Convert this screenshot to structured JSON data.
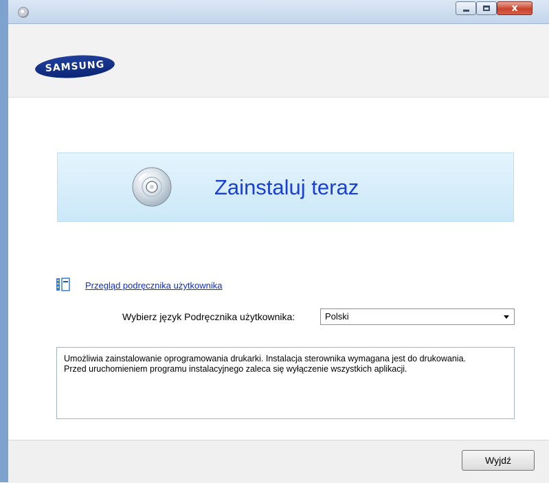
{
  "window": {
    "min_icon": "minimize-icon",
    "max_icon": "maximize-icon",
    "close_icon": "close-icon",
    "close_glyph": "x"
  },
  "header": {
    "logo_text": "SAMSUNG",
    "brand_color": "#0c2674"
  },
  "main": {
    "install_label": "Zainstaluj teraz",
    "install_icon": "cd-disc-icon",
    "guide_link": "Przegląd podręcznika użytkownika",
    "guide_icon": "manual-book-icon",
    "lang_label": "Wybierz język Podręcznika użytkownika:",
    "lang_selected": "Polski",
    "description": [
      "Umożliwia zainstalowanie oprogramowania drukarki. Instalacja sterownika wymagana jest do drukowania.",
      "Przed uruchomieniem programu instalacyjnego zaleca się wyłączenie wszystkich aplikacji."
    ]
  },
  "footer": {
    "exit_label": "Wyjdź"
  },
  "colors": {
    "link": "#0d2bd6",
    "install_text": "#1a3fd6",
    "banner_bg": "#d7eefa"
  }
}
